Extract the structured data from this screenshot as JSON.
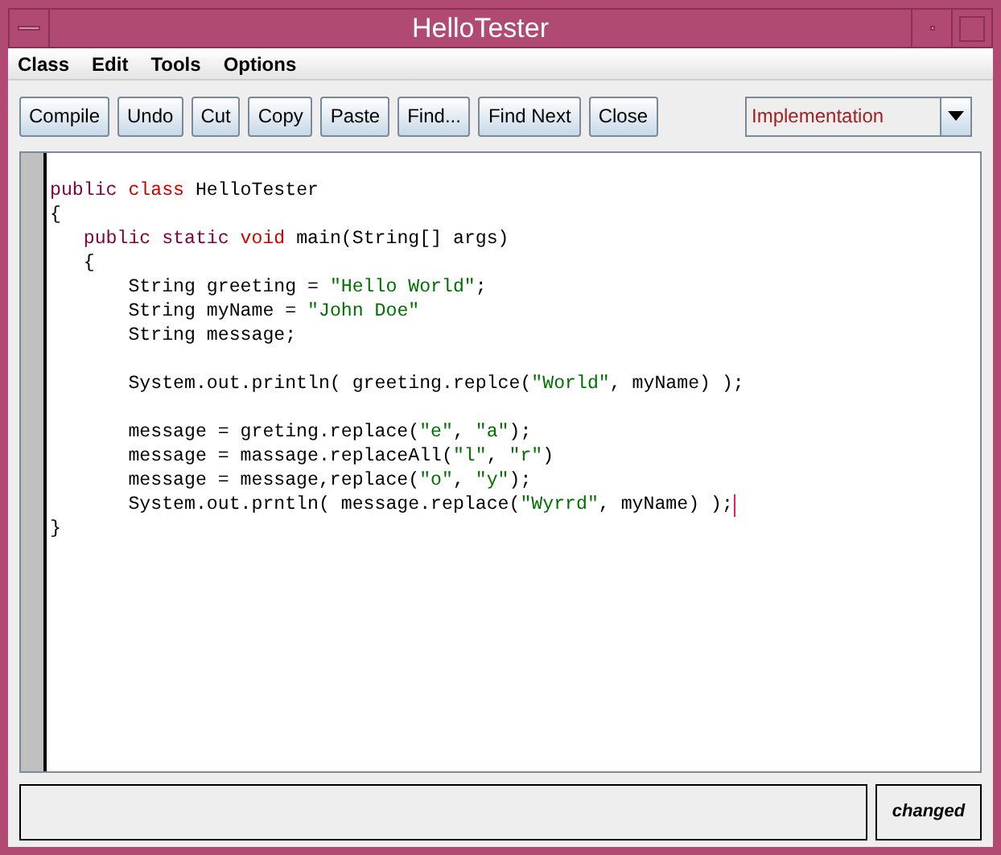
{
  "window": {
    "title": "HelloTester"
  },
  "menu": [
    "Class",
    "Edit",
    "Tools",
    "Options"
  ],
  "toolbar": [
    "Compile",
    "Undo",
    "Cut",
    "Copy",
    "Paste",
    "Find...",
    "Find Next",
    "Close"
  ],
  "view_selector": {
    "value": "Implementation"
  },
  "editor": {
    "lines": [
      {
        "kind": "code",
        "caret": false,
        "tokens": [
          {
            "kind": "keyword",
            "text": "public "
          },
          {
            "kind": "type",
            "text": "class "
          },
          {
            "kind": "plain",
            "text": "HelloTester"
          }
        ]
      },
      {
        "kind": "code",
        "caret": false,
        "tokens": [
          {
            "kind": "plain",
            "text": "{"
          }
        ]
      },
      {
        "kind": "code",
        "caret": false,
        "tokens": [
          {
            "kind": "keyword",
            "text": "   public static "
          },
          {
            "kind": "type",
            "text": "void "
          },
          {
            "kind": "plain",
            "text": "main(String[] args)"
          }
        ]
      },
      {
        "kind": "code",
        "caret": false,
        "tokens": [
          {
            "kind": "plain",
            "text": "   {"
          }
        ]
      },
      {
        "kind": "code",
        "caret": false,
        "tokens": [
          {
            "kind": "plain",
            "text": "       String greeting = "
          },
          {
            "kind": "string",
            "text": "\"Hello World\""
          },
          {
            "kind": "plain",
            "text": ";"
          }
        ]
      },
      {
        "kind": "code",
        "caret": false,
        "tokens": [
          {
            "kind": "plain",
            "text": "       String myName = "
          },
          {
            "kind": "string",
            "text": "\"John Doe\""
          }
        ]
      },
      {
        "kind": "code",
        "caret": false,
        "tokens": [
          {
            "kind": "plain",
            "text": "       String message;"
          }
        ]
      },
      {
        "kind": "blank"
      },
      {
        "kind": "code",
        "caret": false,
        "tokens": [
          {
            "kind": "plain",
            "text": "       System.out.println( greeting.replce("
          },
          {
            "kind": "string",
            "text": "\"World\""
          },
          {
            "kind": "plain",
            "text": ", myName) );"
          }
        ]
      },
      {
        "kind": "blank"
      },
      {
        "kind": "code",
        "caret": false,
        "tokens": [
          {
            "kind": "plain",
            "text": "       message = greting.replace("
          },
          {
            "kind": "string",
            "text": "\"e\""
          },
          {
            "kind": "plain",
            "text": ", "
          },
          {
            "kind": "string",
            "text": "\"a\""
          },
          {
            "kind": "plain",
            "text": ");"
          }
        ]
      },
      {
        "kind": "code",
        "caret": false,
        "tokens": [
          {
            "kind": "plain",
            "text": "       message = massage.replaceAll("
          },
          {
            "kind": "string",
            "text": "\"l\""
          },
          {
            "kind": "plain",
            "text": ", "
          },
          {
            "kind": "string",
            "text": "\"r\""
          },
          {
            "kind": "plain",
            "text": ")"
          }
        ]
      },
      {
        "kind": "code",
        "caret": false,
        "tokens": [
          {
            "kind": "plain",
            "text": "       message = message,replace("
          },
          {
            "kind": "string",
            "text": "\"o\""
          },
          {
            "kind": "plain",
            "text": ", "
          },
          {
            "kind": "string",
            "text": "\"y\""
          },
          {
            "kind": "plain",
            "text": ");"
          }
        ]
      },
      {
        "kind": "code",
        "caret": true,
        "tokens": [
          {
            "kind": "plain",
            "text": "       System.out.prntln( message.replace("
          },
          {
            "kind": "string",
            "text": "\"Wyrrd\""
          },
          {
            "kind": "plain",
            "text": ", myName) );"
          }
        ]
      },
      {
        "kind": "code",
        "caret": false,
        "tokens": [
          {
            "kind": "plain",
            "text": "}"
          }
        ]
      }
    ]
  },
  "status_bar": {
    "state": "changed"
  }
}
